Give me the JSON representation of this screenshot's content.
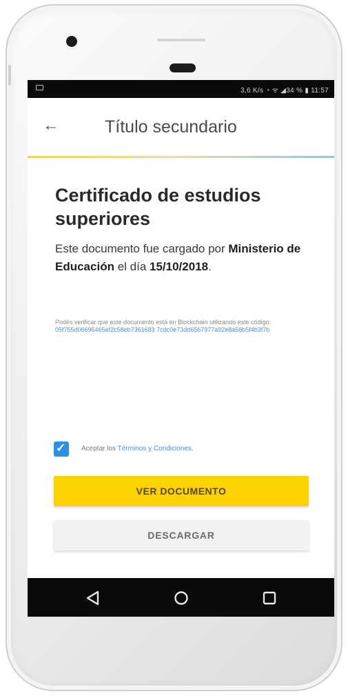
{
  "status_bar": {
    "text": "3,6 K/s ◔ ᯤ ◢34 % ▮ 11:57"
  },
  "app_bar": {
    "title": "Título secundario"
  },
  "document": {
    "title": "Certificado de estudios superiores",
    "desc_prefix": "Este documento fue cargado por ",
    "issuer": "Ministerio de Educación",
    "desc_middle": " el día ",
    "date": "15/10/2018",
    "desc_suffix": "."
  },
  "verification": {
    "text": "Podés verificar que este documento está en Blockchain utilizando este código:",
    "code": "05f755d06696465ef2c58eb7361683 7cdc0e73dd6567977a92e8a58b5f4b3f7b"
  },
  "terms": {
    "checked": true,
    "prefix": "Aceptar los ",
    "link": "Términos y Condiciones",
    "suffix": "."
  },
  "buttons": {
    "view_label": "VER DOCUMENTO",
    "download_label": "DESCARGAR"
  },
  "colors": {
    "accent_yellow": "#fcd200",
    "link_blue": "#4a8fd9",
    "checkbox_blue": "#2f8fe0"
  },
  "icons": {
    "back": "arrow-left-icon",
    "nav_back": "triangle-back-icon",
    "nav_home": "circle-home-icon",
    "nav_recent": "square-recent-icon"
  }
}
